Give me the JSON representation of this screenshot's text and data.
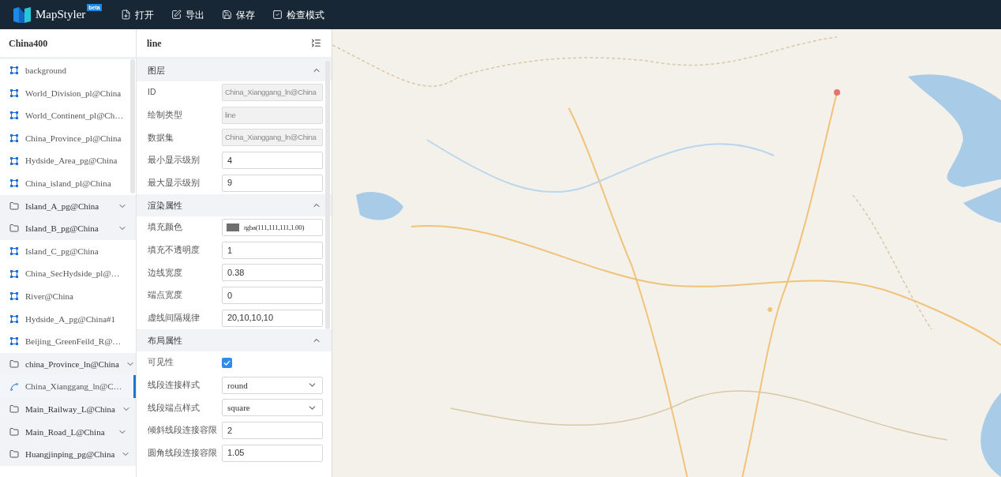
{
  "app": {
    "name": "MapStyler",
    "badge": "beta"
  },
  "toolbar": [
    {
      "label": "打开"
    },
    {
      "label": "导出"
    },
    {
      "label": "保存"
    },
    {
      "label": "检查模式"
    }
  ],
  "layers": {
    "title": "China400",
    "items": [
      {
        "kind": "layer",
        "label": "background",
        "selected": false
      },
      {
        "kind": "layer",
        "label": "World_Division_pl@China",
        "selected": false
      },
      {
        "kind": "layer",
        "label": "World_Continent_pl@Ch…",
        "selected": false
      },
      {
        "kind": "layer",
        "label": "China_Province_pl@China",
        "selected": false
      },
      {
        "kind": "layer",
        "label": "Hydside_Area_pg@China",
        "selected": false
      },
      {
        "kind": "layer",
        "label": "China_island_pl@China",
        "selected": false
      },
      {
        "kind": "group",
        "label": "Island_A_pg@China",
        "selected": false
      },
      {
        "kind": "group",
        "label": "Island_B_pg@China",
        "selected": false
      },
      {
        "kind": "layer",
        "label": "Island_C_pg@China",
        "selected": false
      },
      {
        "kind": "layer",
        "label": "China_SecHydside_pl@…",
        "selected": false
      },
      {
        "kind": "layer",
        "label": "River@China",
        "selected": false
      },
      {
        "kind": "layer",
        "label": "Hydside_A_pg@China#1",
        "selected": false
      },
      {
        "kind": "layer",
        "label": "Beijing_GreenFeild_R@…",
        "selected": false
      },
      {
        "kind": "group",
        "label": "china_Province_ln@China",
        "selected": false
      },
      {
        "kind": "line",
        "label": "China_Xianggang_ln@C…",
        "selected": true
      },
      {
        "kind": "group",
        "label": "Main_Railway_L@China",
        "selected": false
      },
      {
        "kind": "group",
        "label": "Main_Road_L@China",
        "selected": false
      },
      {
        "kind": "group",
        "label": "Huangjinping_pg@China",
        "selected": false
      }
    ]
  },
  "panel": {
    "title": "line",
    "sections": [
      {
        "title": "图层",
        "expanded": true,
        "fields": [
          {
            "kind": "readonly",
            "label": "ID",
            "value": "China_Xianggang_ln@China"
          },
          {
            "kind": "readonly",
            "label": "绘制类型",
            "value": "line"
          },
          {
            "kind": "readonly",
            "label": "数据集",
            "value": "China_Xianggang_ln@China"
          },
          {
            "kind": "input",
            "label": "最小显示级别",
            "value": "4"
          },
          {
            "kind": "input",
            "label": "最大显示级别",
            "value": "9"
          }
        ]
      },
      {
        "title": "渲染属性",
        "expanded": true,
        "fields": [
          {
            "kind": "color",
            "label": "填充颜色",
            "value": "rgba(111,111,111,1.00)",
            "color": "#6f6f6f"
          },
          {
            "kind": "input",
            "label": "填充不透明度",
            "value": "1"
          },
          {
            "kind": "input",
            "label": "边线宽度",
            "value": "0.38"
          },
          {
            "kind": "input",
            "label": "端点宽度",
            "value": "0"
          },
          {
            "kind": "input",
            "label": "虚线间隔规律",
            "value": "20,10,10,10"
          }
        ]
      },
      {
        "title": "布局属性",
        "expanded": true,
        "fields": [
          {
            "kind": "checkbox",
            "label": "可见性",
            "checked": true
          },
          {
            "kind": "select",
            "label": "线段连接样式",
            "value": "round"
          },
          {
            "kind": "select",
            "label": "线段端点样式",
            "value": "square"
          },
          {
            "kind": "input",
            "label": "倾斜线段连接容限",
            "value": "2"
          },
          {
            "kind": "input",
            "label": "圆角线段连接容限",
            "value": "1.05"
          }
        ]
      }
    ]
  }
}
